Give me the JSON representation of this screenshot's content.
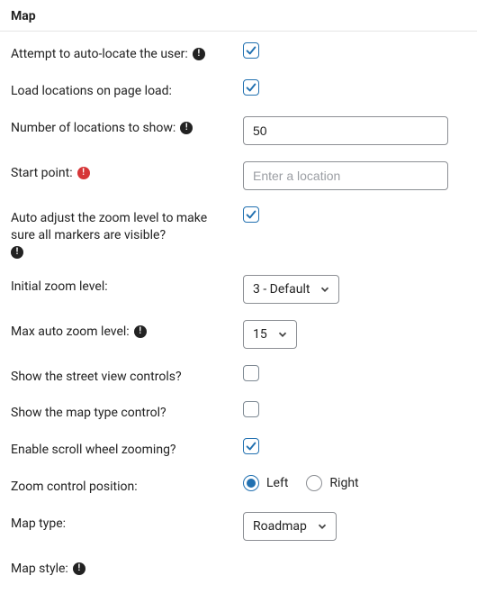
{
  "section_title": "Map",
  "fields": {
    "auto_locate": {
      "label": "Attempt to auto-locate the user:",
      "info": true,
      "checked": true
    },
    "load_on_page": {
      "label": "Load locations on page load:",
      "info": false,
      "checked": true
    },
    "num_locations": {
      "label": "Number of locations to show:",
      "info": true,
      "value": "50"
    },
    "start_point": {
      "label": "Start point:",
      "alert": true,
      "placeholder": "Enter a location",
      "value": ""
    },
    "auto_zoom": {
      "label": "Auto adjust the zoom level to make sure all markers are visible?",
      "info": true,
      "checked": true
    },
    "initial_zoom": {
      "label": "Initial zoom level:",
      "value": "3 - Default"
    },
    "max_auto_zoom": {
      "label": "Max auto zoom level:",
      "info": true,
      "value": "15"
    },
    "street_view": {
      "label": "Show the street view controls?",
      "checked": false
    },
    "map_type_ctrl": {
      "label": "Show the map type control?",
      "checked": false
    },
    "scroll_zoom": {
      "label": "Enable scroll wheel zooming?",
      "checked": true
    },
    "zoom_ctrl_pos": {
      "label": "Zoom control position:",
      "option_left": "Left",
      "option_right": "Right",
      "selected": "left"
    },
    "map_type": {
      "label": "Map type:",
      "value": "Roadmap"
    },
    "map_style": {
      "label": "Map style:",
      "info": true
    }
  },
  "glyph_info": "!"
}
